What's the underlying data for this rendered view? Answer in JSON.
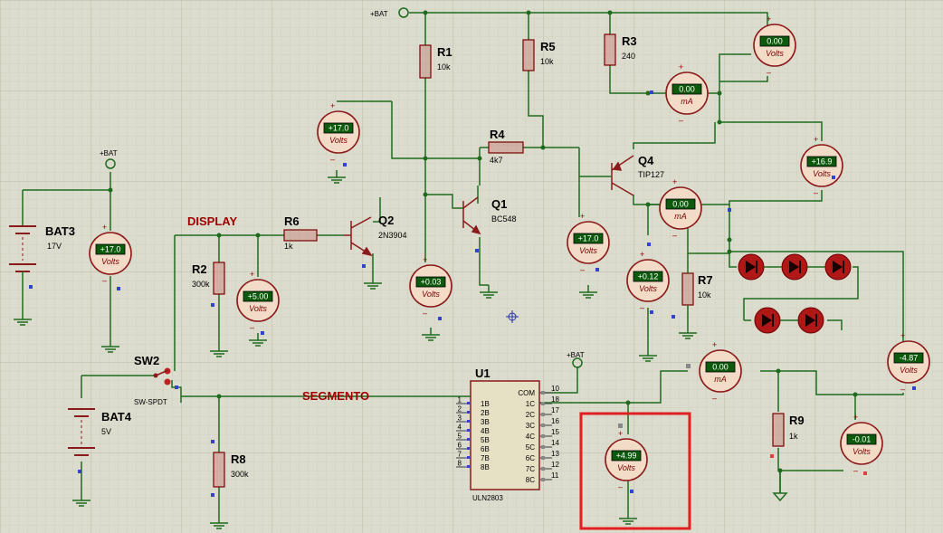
{
  "nets": {
    "bat_label": "+BAT"
  },
  "labels": {
    "display": "DISPLAY",
    "segmento": "SEGMENTO"
  },
  "components": {
    "r1": {
      "ref": "R1",
      "value": "10k"
    },
    "r2": {
      "ref": "R2",
      "value": "300k"
    },
    "r3": {
      "ref": "R3",
      "value": "240"
    },
    "r4": {
      "ref": "R4",
      "value": "4k7"
    },
    "r5": {
      "ref": "R5",
      "value": "10k"
    },
    "r6": {
      "ref": "R6",
      "value": "1k"
    },
    "r7": {
      "ref": "R7",
      "value": "10k"
    },
    "r8": {
      "ref": "R8",
      "value": "300k"
    },
    "r9": {
      "ref": "R9",
      "value": "1k"
    },
    "q1": {
      "ref": "Q1",
      "value": "BC548"
    },
    "q2": {
      "ref": "Q2",
      "value": "2N3904"
    },
    "q4": {
      "ref": "Q4",
      "value": "TIP127"
    },
    "bat3": {
      "ref": "BAT3",
      "value": "17V"
    },
    "bat4": {
      "ref": "BAT4",
      "value": "5V"
    },
    "sw2": {
      "ref": "SW2",
      "value": "SW-SPDT"
    },
    "u1": {
      "ref": "U1",
      "value": "ULN2803",
      "left_pins": [
        {
          "num": "1",
          "name": "1B"
        },
        {
          "num": "2",
          "name": "2B"
        },
        {
          "num": "3",
          "name": "3B"
        },
        {
          "num": "4",
          "name": "4B"
        },
        {
          "num": "5",
          "name": "5B"
        },
        {
          "num": "6",
          "name": "6B"
        },
        {
          "num": "7",
          "name": "7B"
        },
        {
          "num": "8",
          "name": "8B"
        }
      ],
      "right_pins": [
        {
          "num": "10",
          "name": "COM"
        },
        {
          "num": "18",
          "name": "1C"
        },
        {
          "num": "17",
          "name": "2C"
        },
        {
          "num": "16",
          "name": "3C"
        },
        {
          "num": "15",
          "name": "4C"
        },
        {
          "num": "14",
          "name": "5C"
        },
        {
          "num": "13",
          "name": "6C"
        },
        {
          "num": "12",
          "name": "7C"
        },
        {
          "num": "11",
          "name": "8C"
        }
      ]
    }
  },
  "meters": {
    "v_top": {
      "reading": "0.00",
      "unit": "Volts"
    },
    "ma_r3": {
      "reading": "0.00",
      "unit": "mA"
    },
    "v_q2b": {
      "reading": "+17.0",
      "unit": "Volts"
    },
    "v_q4e": {
      "reading": "+16.9",
      "unit": "Volts"
    },
    "v_bat3": {
      "reading": "+17.0",
      "unit": "Volts"
    },
    "v_disp": {
      "reading": "+5.00",
      "unit": "Volts"
    },
    "v_q2c": {
      "reading": "+0.03",
      "unit": "Volts"
    },
    "v_q4b": {
      "reading": "+17.0",
      "unit": "Volts"
    },
    "ma_q4": {
      "reading": "0.00",
      "unit": "mA"
    },
    "v_r7": {
      "reading": "+0.12",
      "unit": "Volts"
    },
    "ma_led": {
      "reading": "0.00",
      "unit": "mA"
    },
    "v_led": {
      "reading": "-4.87",
      "unit": "Volts"
    },
    "v_r9": {
      "reading": "-0.01",
      "unit": "Volts"
    },
    "v_seg": {
      "reading": "+4.99",
      "unit": "Volts"
    }
  },
  "colors": {
    "wire": "#1e6b1e",
    "component": "#8b1a1a",
    "lcd": "#1a7a1a",
    "highlight": "#e02020",
    "background": "#dcdcce"
  }
}
